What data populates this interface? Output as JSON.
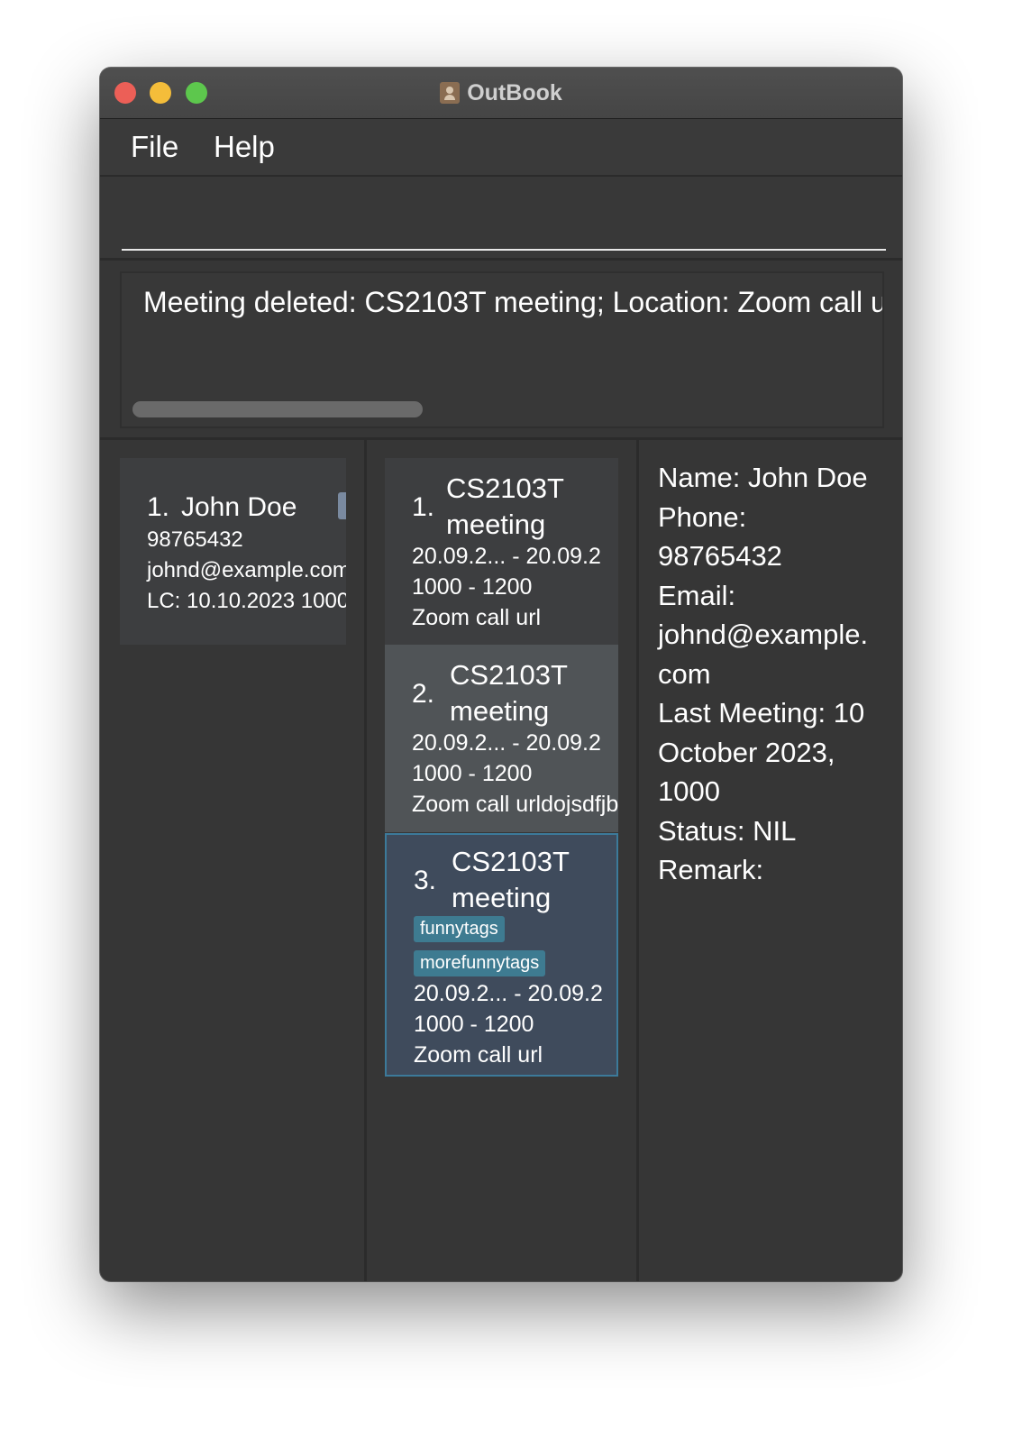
{
  "window": {
    "title": "OutBook"
  },
  "menu": {
    "items": [
      "File",
      "Help"
    ]
  },
  "command": {
    "value": "",
    "placeholder": ""
  },
  "result": {
    "text": "Meeting deleted: CS2103T meeting; Location: Zoom call u"
  },
  "persons": [
    {
      "index": "1.",
      "name": "John Doe",
      "phone": "98765432",
      "email": "johnd@example.com",
      "last_contact": "LC: 10.10.2023 1000"
    }
  ],
  "meetings": [
    {
      "index": "1.",
      "title_line1": "CS2103T",
      "title_line2": "meeting",
      "tags": [],
      "date_range": "20.09.2...  -  20.09.2",
      "time_range": "1000  -  1200",
      "location": "Zoom call url"
    },
    {
      "index": "2.",
      "title_line1": "CS2103T",
      "title_line2": "meeting",
      "tags": [],
      "date_range": "20.09.2...  -  20.09.2",
      "time_range": "1000  -  1200",
      "location": "Zoom call urldojsdfjbs"
    },
    {
      "index": "3.",
      "title_line1": "CS2103T",
      "title_line2": "meeting",
      "tags": [
        "funnytags",
        "morefunnytags"
      ],
      "date_range": "20.09.2...  -  20.09.2",
      "time_range": "1000  -  1200",
      "location": "Zoom call url"
    }
  ],
  "detail": {
    "name": "Name: John Doe",
    "phone_label": "Phone:",
    "phone": "98765432",
    "email_label": "Email:",
    "email_line1": "johnd@example.",
    "email_line2": "com",
    "last_meeting_line1": "Last Meeting: 10",
    "last_meeting_line2": "October 2023,",
    "last_meeting_line3": "1000",
    "status": "Status: NIL",
    "remark": "Remark:"
  },
  "colors": {
    "window_bg": "#363636",
    "selected_card_border": "#3c7a9a",
    "tag_bg": "#3e7b91"
  }
}
